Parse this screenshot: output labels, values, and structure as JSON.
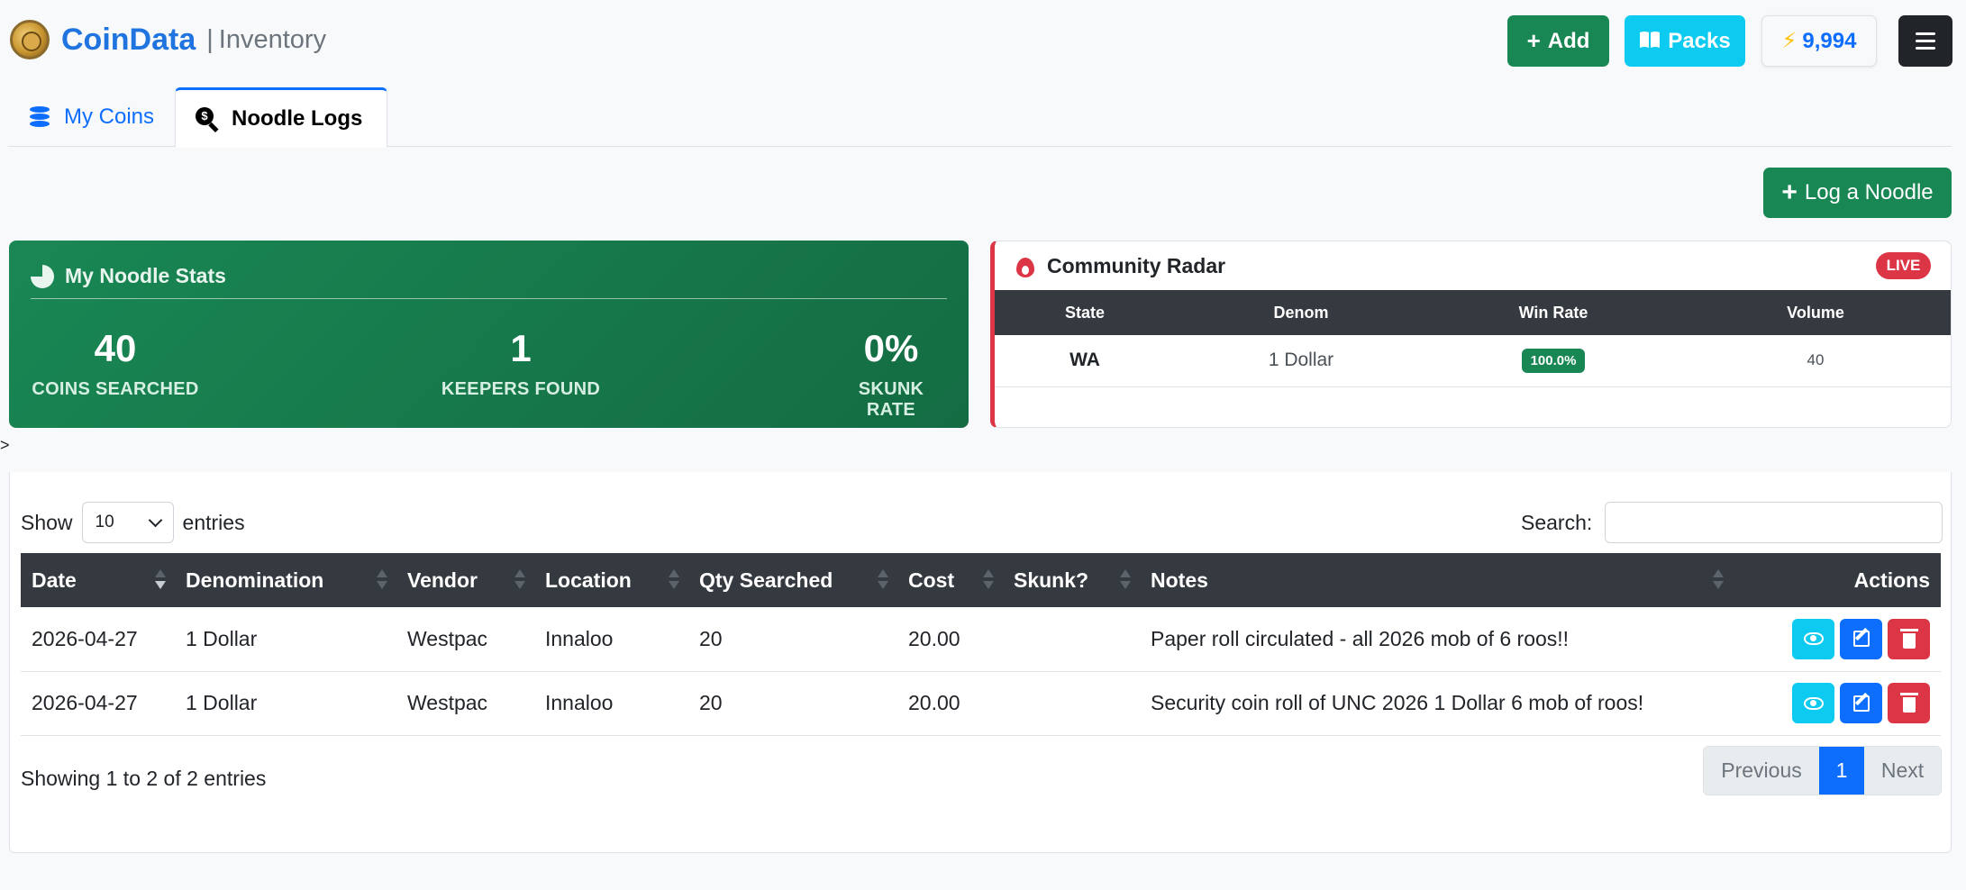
{
  "header": {
    "brand": "CoinData",
    "section": "Inventory",
    "separator": "|",
    "add_label": "Add",
    "packs_label": "Packs",
    "credits": "9,994"
  },
  "tabs": [
    {
      "label": "My Coins",
      "active": false
    },
    {
      "label": "Noodle Logs",
      "active": true
    }
  ],
  "log_button": "Log a Noodle",
  "stats": {
    "title": "My Noodle Stats",
    "items": [
      {
        "value": "40",
        "label": "COINS SEARCHED"
      },
      {
        "value": "1",
        "label": "KEEPERS FOUND"
      },
      {
        "value": "0%",
        "label": "SKUNK RATE"
      }
    ]
  },
  "radar": {
    "title": "Community Radar",
    "badge": "LIVE",
    "columns": [
      "State",
      "Denom",
      "Win Rate",
      "Volume"
    ],
    "rows": [
      {
        "state": "WA",
        "denom": "1 Dollar",
        "win_rate": "100.0%",
        "volume": "40"
      }
    ]
  },
  "stray_text": ">",
  "table": {
    "length_prefix": "Show",
    "length_value": "10",
    "length_suffix": "entries",
    "search_label": "Search:",
    "search_value": "",
    "columns": [
      "Date",
      "Denomination",
      "Vendor",
      "Location",
      "Qty Searched",
      "Cost",
      "Skunk?",
      "Notes",
      "Actions"
    ],
    "rows": [
      {
        "date": "2026-04-27",
        "denomination": "1 Dollar",
        "vendor": "Westpac",
        "location": "Innaloo",
        "qty": "20",
        "cost": "20.00",
        "skunk": "",
        "notes": "Paper roll circulated - all 2026 mob of 6 roos!!"
      },
      {
        "date": "2026-04-27",
        "denomination": "1 Dollar",
        "vendor": "Westpac",
        "location": "Innaloo",
        "qty": "20",
        "cost": "20.00",
        "skunk": "",
        "notes": "Security coin roll of UNC 2026 1 Dollar 6 mob of roos!"
      }
    ],
    "info": "Showing 1 to 2 of 2 entries",
    "pager": {
      "previous": "Previous",
      "page": "1",
      "next": "Next"
    }
  },
  "colors": {
    "primary": "#0d6efd",
    "success": "#198754",
    "info": "#0dcaf0",
    "danger": "#dc3545",
    "dark": "#343a40"
  },
  "icons": [
    "coin-logo-icon",
    "plus-icon",
    "book-icon",
    "bolt-icon",
    "hamburger-icon",
    "coins-stack-icon",
    "search-dollar-icon",
    "pie-chart-icon",
    "fire-icon",
    "eye-icon",
    "edit-icon",
    "trash-icon"
  ]
}
